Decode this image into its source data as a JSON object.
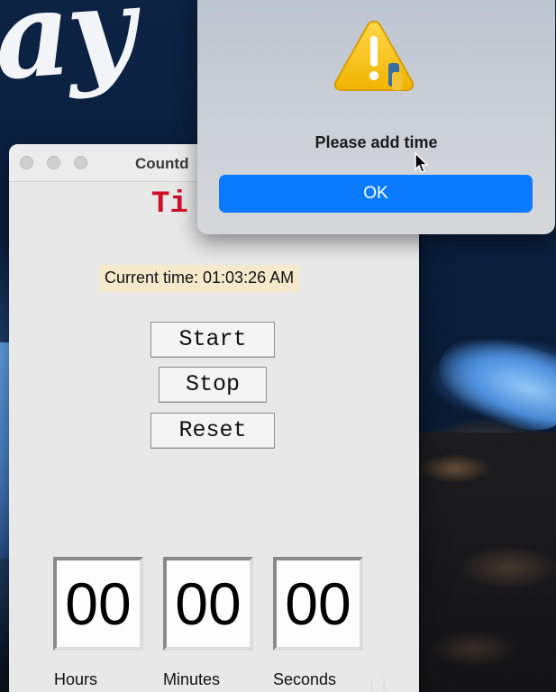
{
  "wallpaper": {
    "text": "ay"
  },
  "app_window": {
    "title": "Countd",
    "heading": "Ti",
    "current_time": "Current time: 01:03:26 AM",
    "buttons": {
      "start": "Start",
      "stop": "Stop",
      "reset": "Reset"
    },
    "digits": {
      "hours": "00",
      "minutes": "00",
      "seconds": "00"
    },
    "labels": {
      "hours": "Hours",
      "minutes": "Minutes",
      "seconds": "Seconds"
    }
  },
  "alert": {
    "icon": "warning-python-icon",
    "message": "Please add time",
    "ok_label": "OK"
  },
  "colors": {
    "heading_red": "#d0102a",
    "ok_blue": "#0a7bff",
    "time_highlight": "#f5e9cc"
  },
  "watermark": "i i"
}
